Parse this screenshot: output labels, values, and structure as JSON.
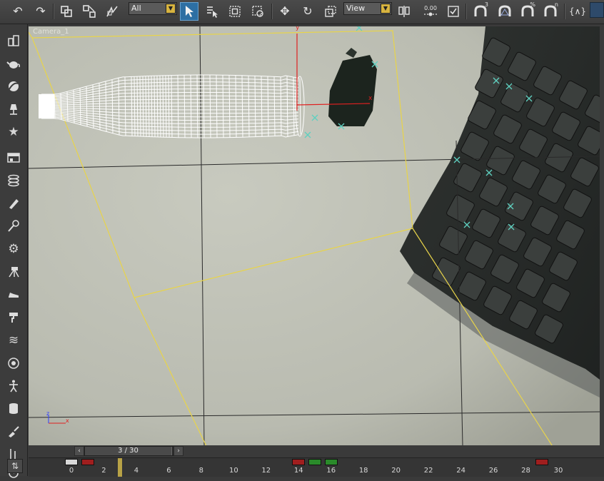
{
  "toolbar": {
    "selection_filter": "All",
    "reference_coord": "View",
    "spinner_snap_value": "0.00",
    "angle_snap_label": "3",
    "percent_snap_label": "%",
    "spinner_snap_label": "n",
    "curly_label": "{∧}"
  },
  "viewport": {
    "label": "Camera_1",
    "axis_x": "x",
    "axis_y": "y",
    "axis_z": "z",
    "gizmo_y": "y",
    "gizmo_x": "x",
    "colors": {
      "frustum": "#e8d44a",
      "tracker_marks": "#5fd0c0",
      "gizmo": "#e02020"
    }
  },
  "timeline": {
    "frame_display": "3 / 30",
    "current_frame": 3,
    "total_frames": 30,
    "tick_labels": [
      "0",
      "2",
      "4",
      "6",
      "8",
      "10",
      "12",
      "14",
      "16",
      "18",
      "20",
      "22",
      "24",
      "26",
      "28",
      "30"
    ],
    "keys": [
      {
        "frame": 0,
        "color": "#d8d8d8"
      },
      {
        "frame": 1,
        "color": "#a01e1e"
      },
      {
        "frame": 14,
        "color": "#a01e1e"
      },
      {
        "frame": 15,
        "color": "#2a8a2a"
      },
      {
        "frame": 16,
        "color": "#2a8a2a"
      },
      {
        "frame": 29,
        "color": "#a01e1e"
      }
    ]
  }
}
